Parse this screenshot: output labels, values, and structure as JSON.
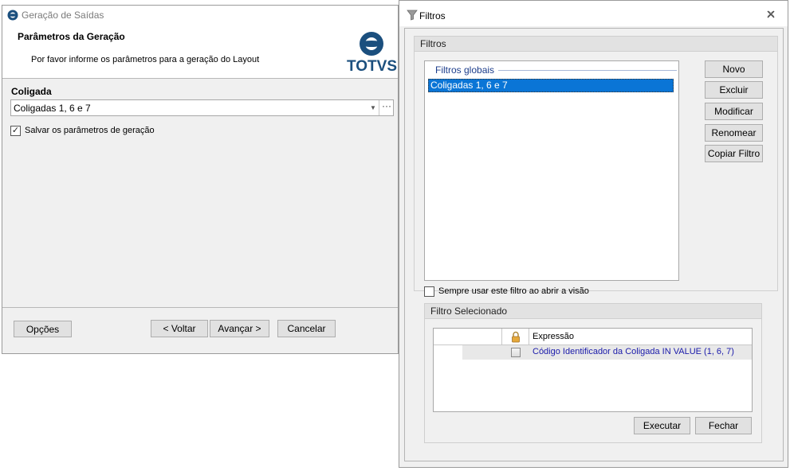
{
  "wizard": {
    "title": "Geração de Saídas",
    "header_title": "Parâmetros da Geração",
    "header_subtitle": "Por favor informe os parâmetros para a geração do Layout",
    "logo_text": "TOTVS",
    "coligada_label": "Coligada",
    "coligada_value": "Coligadas 1, 6 e 7",
    "save_params_label": "Salvar os parâmetros de geração",
    "save_params_checked": true,
    "buttons": {
      "options": "Opções",
      "back": "< Voltar",
      "next": "Avançar >",
      "cancel": "Cancelar"
    }
  },
  "filtros": {
    "title": "Filtros",
    "group_title": "Filtros",
    "list_header": "Filtros globais",
    "list_items": [
      "Coligadas 1, 6 e 7"
    ],
    "selected_item": "Coligadas 1, 6 e 7",
    "buttons": {
      "new": "Novo",
      "delete": "Excluir",
      "modify": "Modificar",
      "rename": "Renomear",
      "copy": "Copiar Filtro"
    },
    "always_use_label": "Sempre usar este filtro ao abrir a visão",
    "always_use_checked": false,
    "selected_group_title": "Filtro Selecionado",
    "grid": {
      "column_expression": "Expressão",
      "rows": [
        {
          "locked": false,
          "expression": "Código Identificador da Coligada IN VALUE (1, 6, 7)"
        }
      ]
    },
    "execute_button": "Executar",
    "close_button": "Fechar"
  },
  "colors": {
    "selection": "#0a75d6",
    "link_text": "#1a1aaa",
    "totvs_blue": "#1b4f7e"
  }
}
